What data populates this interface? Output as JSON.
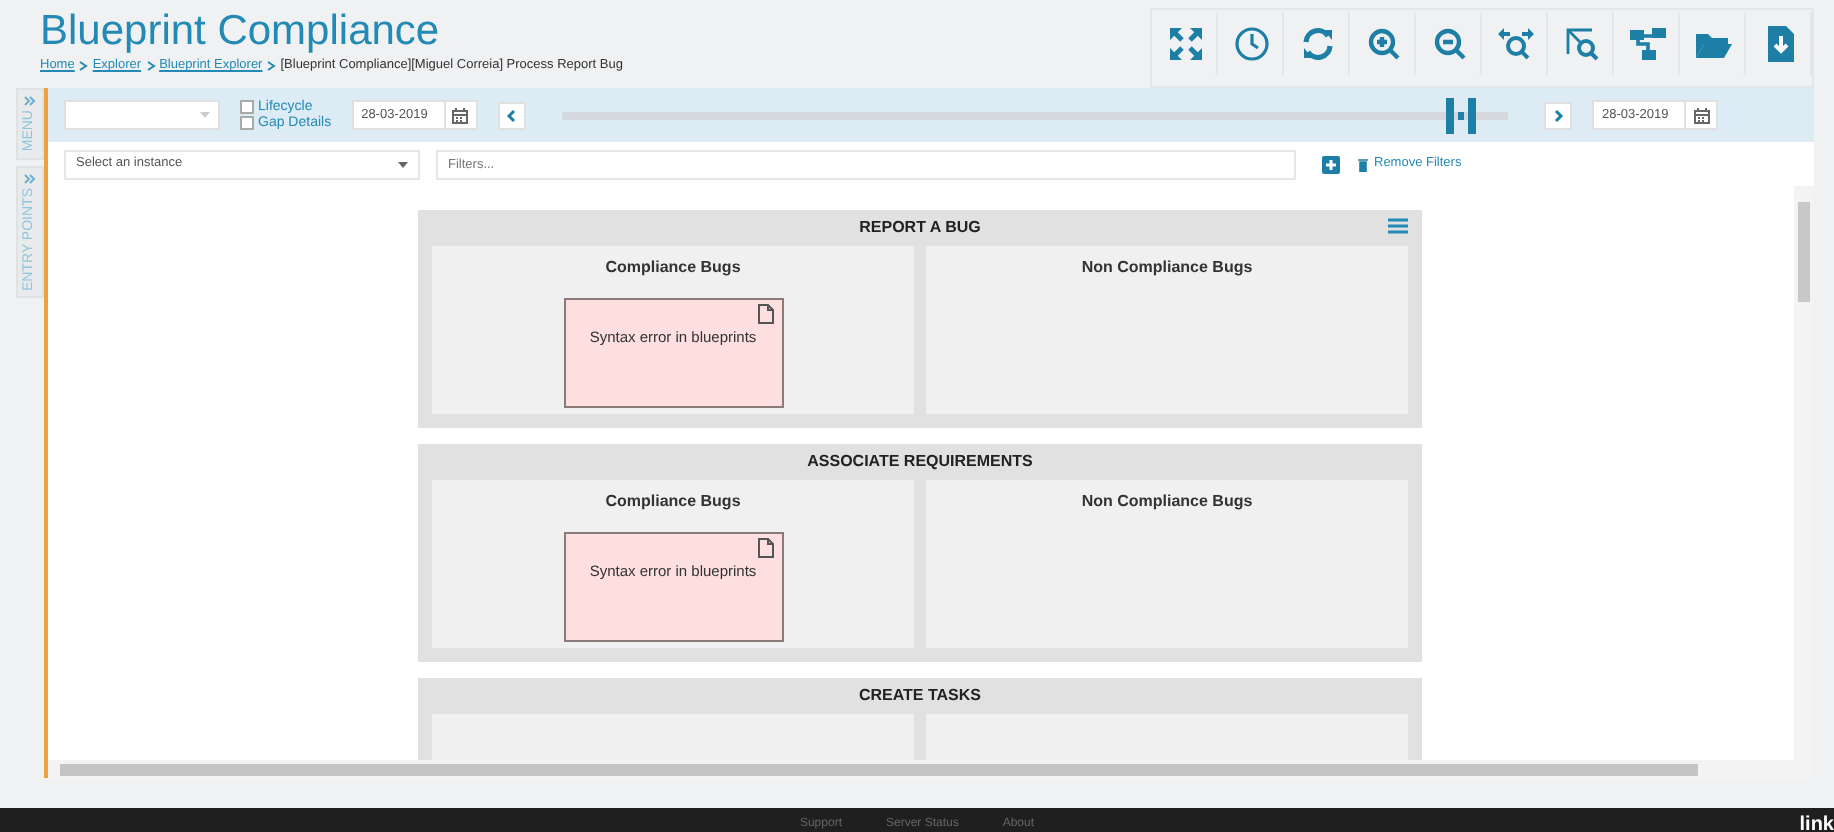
{
  "header": {
    "title": "Blueprint Compliance",
    "breadcrumbs": [
      {
        "label": "Home",
        "link": true
      },
      {
        "label": "Explorer",
        "link": true
      },
      {
        "label": "Blueprint Explorer",
        "link": true
      },
      {
        "label": "[Blueprint Compliance][Miguel Correia] Process Report Bug",
        "link": false
      }
    ]
  },
  "side_tabs": [
    "MENU",
    "ENTRY POINTS"
  ],
  "toolbar": {
    "checkboxes": [
      {
        "label": "Lifecycle",
        "checked": false
      },
      {
        "label": "Gap Details",
        "checked": false
      }
    ],
    "start_date": "28-03-2019",
    "end_date": "28-03-2019",
    "timeline": {
      "level": 0.95
    }
  },
  "filters": {
    "instance_placeholder": "Select an instance",
    "filter_placeholder": "Filters...",
    "remove_label": "Remove Filters"
  },
  "lanes": [
    {
      "title": "REPORT A BUG",
      "menu": true,
      "columns": [
        {
          "title": "Compliance Bugs",
          "cards": [
            "Syntax error in blueprints"
          ]
        },
        {
          "title": "Non Compliance Bugs"
        }
      ]
    },
    {
      "title": "ASSOCIATE REQUIREMENTS",
      "menu": false,
      "columns": [
        {
          "title": "Compliance Bugs",
          "cards": [
            "Syntax error in blueprints"
          ]
        },
        {
          "title": "Non Compliance Bugs"
        }
      ]
    },
    {
      "title": "CREATE TASKS",
      "menu": false,
      "columns": [
        {},
        {}
      ]
    }
  ],
  "footer": {
    "links": [
      "Support",
      "Server Status",
      "About"
    ],
    "logo": "link"
  }
}
